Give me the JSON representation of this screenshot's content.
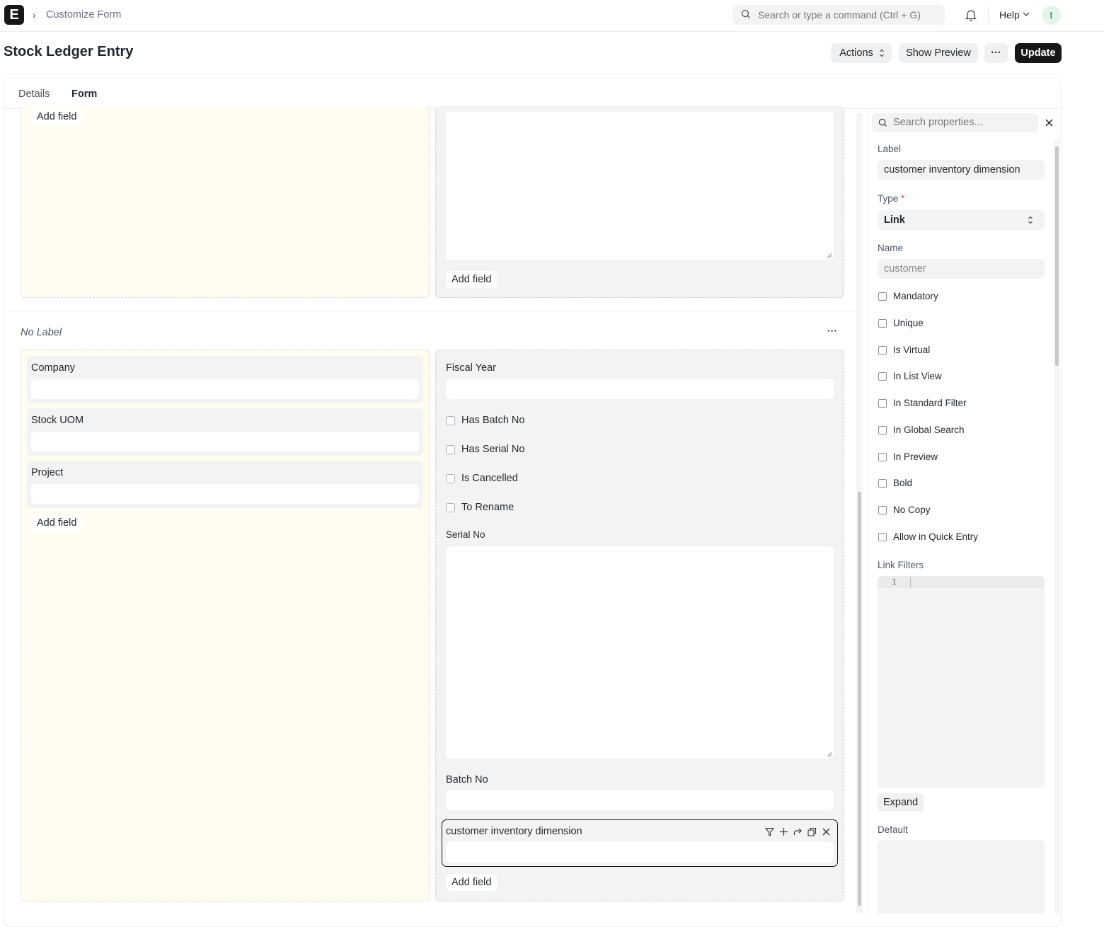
{
  "navbar": {
    "logo": "E",
    "breadcrumb": "Customize Form",
    "search_placeholder": "Search or type a command (Ctrl + G)",
    "help_label": "Help",
    "avatar_initial": "t"
  },
  "page": {
    "title": "Stock Ledger Entry",
    "actions_label": "Actions",
    "show_preview_label": "Show Preview",
    "more_label": "···",
    "update_label": "Update"
  },
  "tabs": [
    {
      "label": "Details",
      "active": false
    },
    {
      "label": "Form",
      "active": true
    }
  ],
  "form": {
    "top_section": {
      "left_add_field": "Add field",
      "right_add_field": "Add field"
    },
    "section": {
      "title": "No Label",
      "menu_label": "···",
      "left_fields": [
        {
          "label": "Company"
        },
        {
          "label": "Stock UOM"
        },
        {
          "label": "Project"
        }
      ],
      "left_add_field": "Add field",
      "right_fields": {
        "fiscal_year": "Fiscal Year",
        "checkboxes": [
          "Has Batch No",
          "Has Serial No",
          "Is Cancelled",
          "To Rename"
        ],
        "serial_no": "Serial No",
        "batch_no": "Batch No",
        "selected_field": "customer inventory dimension"
      },
      "right_add_field": "Add field"
    }
  },
  "properties": {
    "search_placeholder": "Search properties...",
    "label_title": "Label",
    "label_value": "customer inventory dimension",
    "type_title": "Type",
    "type_required_mark": "*",
    "type_value": "Link",
    "name_title": "Name",
    "name_value": "customer",
    "checkboxes": [
      "Mandatory",
      "Unique",
      "Is Virtual",
      "In List View",
      "In Standard Filter",
      "In Global Search",
      "In Preview",
      "Bold",
      "No Copy",
      "Allow in Quick Entry"
    ],
    "link_filters_title": "Link Filters",
    "editor_line_number": "1",
    "expand_label": "Expand",
    "default_title": "Default"
  },
  "colors": {
    "accent_dark": "#171717",
    "column_yellow": "#fffdf2",
    "field_grey": "#f3f3f3"
  }
}
